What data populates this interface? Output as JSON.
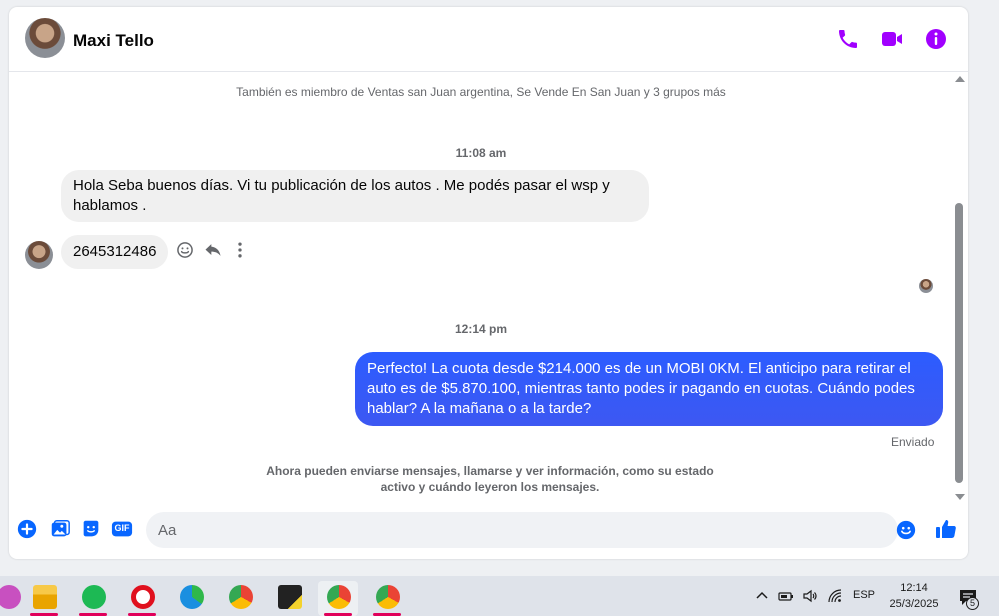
{
  "header": {
    "contact_name": "Maxi Tello",
    "actions": [
      "phone-icon",
      "video-icon",
      "info-icon"
    ],
    "accent_color": "#a100ff"
  },
  "messages": {
    "groups_note": "También es miembro de Ventas san Juan argentina, Se Vende En San Juan y 3 grupos más",
    "time_1": "11:08 am",
    "incoming_1": "Hola Seba buenos días. Vi tu publicación de los autos . Me podés pasar el wsp y hablamos .",
    "incoming_2": "2645312486",
    "time_2": "12:14 pm",
    "outgoing_1": "Perfecto! La cuota desde $214.000 es de un MOBI 0KM. El anticipo para retirar el auto es de $5.870.100, mientras tanto podes ir pagando en cuotas. Cuándo podes hablar? A la mañana o a la tarde?",
    "outgoing_status": "Enviado",
    "info_line_1": "Ahora pueden enviarse mensajes, llamarse y ver información, como su estado",
    "info_line_2": "activo y cuándo leyeron los mensajes.",
    "outgoing_color": "#2f5cff"
  },
  "composer": {
    "placeholder": "Aa",
    "icons": [
      "plus-icon",
      "gallery-icon",
      "sticker-icon",
      "gif-icon",
      "emoji-icon",
      "like-icon"
    ],
    "gif_label": "GIF",
    "accent_color": "#0866ff"
  },
  "taskbar": {
    "language": "ESP",
    "time": "12:14",
    "date": "25/3/2025",
    "notification_count": "5"
  }
}
